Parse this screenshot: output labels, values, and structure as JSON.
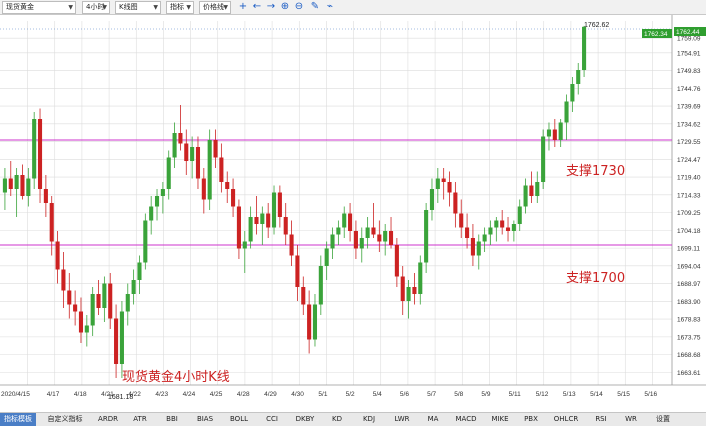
{
  "toolbar": {
    "symbol": "现货黄金",
    "period": "4小时",
    "chart_type": "K线图",
    "indicator": "指标",
    "price_type": "价格线",
    "icons": [
      "crosshair-icon",
      "arrow-left-icon",
      "arrow-right-icon",
      "zoom-in-icon",
      "zoom-out-icon",
      "draw-icon",
      "link-icon"
    ]
  },
  "annotations": {
    "title": "现货黄金4小时K线",
    "support_1730": "支撑1730",
    "support_1700": "支撑1700",
    "high_label": "1762.62",
    "low_label": "1681.18",
    "current_price": "1762.34",
    "current_price_right": "1762.44"
  },
  "colors": {
    "up": "#3aa33a",
    "down": "#cc2222",
    "support_line": "#cc33cc",
    "grid": "#dcdcdc",
    "price_tag": "#2f9e2f"
  },
  "chart_data": {
    "type": "candlestick",
    "title": "现货黄金4小时K线",
    "y_ticks": [
      "1759.09",
      "1754.91",
      "1749.83",
      "1744.76",
      "1739.69",
      "1734.62",
      "1729.55",
      "1724.47",
      "1719.40",
      "1714.33",
      "1709.25",
      "1704.18",
      "1699.11",
      "1694.04",
      "1688.97",
      "1683.90",
      "1678.83",
      "1673.75",
      "1668.68",
      "1663.61"
    ],
    "x_ticks": [
      "2020/4/15",
      "4/17",
      "4/18",
      "4/21",
      "4/22",
      "4/23",
      "4/24",
      "4/25",
      "4/28",
      "4/29",
      "4/30",
      "5/1",
      "5/2",
      "5/4",
      "5/6",
      "5/7",
      "5/8",
      "5/9",
      "5/11",
      "5/12",
      "5/13",
      "5/14",
      "5/15",
      "5/16"
    ],
    "ylim": [
      1660,
      1764
    ],
    "support_levels": [
      1730,
      1700
    ],
    "high": 1762.62,
    "low": 1681.18,
    "series": [
      {
        "o": 1715,
        "h": 1722,
        "l": 1710,
        "c": 1719
      },
      {
        "o": 1719,
        "h": 1724,
        "l": 1714,
        "c": 1716
      },
      {
        "o": 1716,
        "h": 1722,
        "l": 1708,
        "c": 1720
      },
      {
        "o": 1720,
        "h": 1723,
        "l": 1713,
        "c": 1714
      },
      {
        "o": 1714,
        "h": 1722,
        "l": 1711,
        "c": 1719
      },
      {
        "o": 1719,
        "h": 1738,
        "l": 1716,
        "c": 1736
      },
      {
        "o": 1736,
        "h": 1739,
        "l": 1712,
        "c": 1716
      },
      {
        "o": 1716,
        "h": 1720,
        "l": 1708,
        "c": 1712
      },
      {
        "o": 1712,
        "h": 1714,
        "l": 1697,
        "c": 1701
      },
      {
        "o": 1701,
        "h": 1704,
        "l": 1689,
        "c": 1693
      },
      {
        "o": 1693,
        "h": 1698,
        "l": 1682,
        "c": 1687
      },
      {
        "o": 1687,
        "h": 1692,
        "l": 1679,
        "c": 1683
      },
      {
        "o": 1683,
        "h": 1687,
        "l": 1677,
        "c": 1681
      },
      {
        "o": 1681,
        "h": 1685,
        "l": 1672,
        "c": 1675
      },
      {
        "o": 1675,
        "h": 1680,
        "l": 1671,
        "c": 1677
      },
      {
        "o": 1677,
        "h": 1688,
        "l": 1674,
        "c": 1686
      },
      {
        "o": 1686,
        "h": 1690,
        "l": 1680,
        "c": 1682
      },
      {
        "o": 1682,
        "h": 1691,
        "l": 1678,
        "c": 1689
      },
      {
        "o": 1689,
        "h": 1692,
        "l": 1676,
        "c": 1679
      },
      {
        "o": 1679,
        "h": 1683,
        "l": 1662,
        "c": 1666
      },
      {
        "o": 1666,
        "h": 1684,
        "l": 1662,
        "c": 1681
      },
      {
        "o": 1681,
        "h": 1689,
        "l": 1677,
        "c": 1686
      },
      {
        "o": 1686,
        "h": 1693,
        "l": 1683,
        "c": 1690
      },
      {
        "o": 1690,
        "h": 1697,
        "l": 1686,
        "c": 1695
      },
      {
        "o": 1695,
        "h": 1709,
        "l": 1693,
        "c": 1707
      },
      {
        "o": 1707,
        "h": 1714,
        "l": 1703,
        "c": 1711
      },
      {
        "o": 1711,
        "h": 1716,
        "l": 1707,
        "c": 1714
      },
      {
        "o": 1714,
        "h": 1718,
        "l": 1709,
        "c": 1716
      },
      {
        "o": 1716,
        "h": 1727,
        "l": 1713,
        "c": 1725
      },
      {
        "o": 1725,
        "h": 1735,
        "l": 1722,
        "c": 1732
      },
      {
        "o": 1732,
        "h": 1740,
        "l": 1727,
        "c": 1729
      },
      {
        "o": 1729,
        "h": 1733,
        "l": 1720,
        "c": 1724
      },
      {
        "o": 1724,
        "h": 1731,
        "l": 1719,
        "c": 1728
      },
      {
        "o": 1728,
        "h": 1731,
        "l": 1716,
        "c": 1719
      },
      {
        "o": 1719,
        "h": 1722,
        "l": 1709,
        "c": 1713
      },
      {
        "o": 1713,
        "h": 1733,
        "l": 1710,
        "c": 1730
      },
      {
        "o": 1730,
        "h": 1733,
        "l": 1722,
        "c": 1725
      },
      {
        "o": 1725,
        "h": 1729,
        "l": 1715,
        "c": 1718
      },
      {
        "o": 1718,
        "h": 1721,
        "l": 1712,
        "c": 1716
      },
      {
        "o": 1716,
        "h": 1719,
        "l": 1708,
        "c": 1711
      },
      {
        "o": 1711,
        "h": 1713,
        "l": 1696,
        "c": 1699
      },
      {
        "o": 1699,
        "h": 1704,
        "l": 1692,
        "c": 1701
      },
      {
        "o": 1701,
        "h": 1711,
        "l": 1699,
        "c": 1708
      },
      {
        "o": 1708,
        "h": 1714,
        "l": 1703,
        "c": 1706
      },
      {
        "o": 1706,
        "h": 1711,
        "l": 1700,
        "c": 1709
      },
      {
        "o": 1709,
        "h": 1712,
        "l": 1702,
        "c": 1705
      },
      {
        "o": 1705,
        "h": 1717,
        "l": 1703,
        "c": 1715
      },
      {
        "o": 1715,
        "h": 1717,
        "l": 1705,
        "c": 1708
      },
      {
        "o": 1708,
        "h": 1712,
        "l": 1700,
        "c": 1703
      },
      {
        "o": 1703,
        "h": 1707,
        "l": 1694,
        "c": 1697
      },
      {
        "o": 1697,
        "h": 1700,
        "l": 1684,
        "c": 1688
      },
      {
        "o": 1688,
        "h": 1691,
        "l": 1680,
        "c": 1683
      },
      {
        "o": 1683,
        "h": 1687,
        "l": 1669,
        "c": 1673
      },
      {
        "o": 1673,
        "h": 1686,
        "l": 1671,
        "c": 1683
      },
      {
        "o": 1683,
        "h": 1697,
        "l": 1680,
        "c": 1694
      },
      {
        "o": 1694,
        "h": 1701,
        "l": 1690,
        "c": 1699
      },
      {
        "o": 1699,
        "h": 1705,
        "l": 1696,
        "c": 1703
      },
      {
        "o": 1703,
        "h": 1707,
        "l": 1700,
        "c": 1705
      },
      {
        "o": 1705,
        "h": 1711,
        "l": 1702,
        "c": 1709
      },
      {
        "o": 1709,
        "h": 1712,
        "l": 1701,
        "c": 1704
      },
      {
        "o": 1704,
        "h": 1707,
        "l": 1696,
        "c": 1699
      },
      {
        "o": 1699,
        "h": 1705,
        "l": 1695,
        "c": 1702
      },
      {
        "o": 1702,
        "h": 1708,
        "l": 1699,
        "c": 1705
      },
      {
        "o": 1705,
        "h": 1712,
        "l": 1702,
        "c": 1703
      },
      {
        "o": 1703,
        "h": 1707,
        "l": 1698,
        "c": 1701
      },
      {
        "o": 1701,
        "h": 1706,
        "l": 1697,
        "c": 1704
      },
      {
        "o": 1704,
        "h": 1708,
        "l": 1699,
        "c": 1700
      },
      {
        "o": 1700,
        "h": 1702,
        "l": 1688,
        "c": 1691
      },
      {
        "o": 1691,
        "h": 1694,
        "l": 1680,
        "c": 1684
      },
      {
        "o": 1684,
        "h": 1690,
        "l": 1679,
        "c": 1688
      },
      {
        "o": 1688,
        "h": 1692,
        "l": 1683,
        "c": 1686
      },
      {
        "o": 1686,
        "h": 1697,
        "l": 1683,
        "c": 1695
      },
      {
        "o": 1695,
        "h": 1712,
        "l": 1692,
        "c": 1710
      },
      {
        "o": 1710,
        "h": 1719,
        "l": 1707,
        "c": 1716
      },
      {
        "o": 1716,
        "h": 1722,
        "l": 1712,
        "c": 1719
      },
      {
        "o": 1719,
        "h": 1722,
        "l": 1713,
        "c": 1718
      },
      {
        "o": 1718,
        "h": 1721,
        "l": 1711,
        "c": 1715
      },
      {
        "o": 1715,
        "h": 1718,
        "l": 1705,
        "c": 1709
      },
      {
        "o": 1709,
        "h": 1713,
        "l": 1702,
        "c": 1705
      },
      {
        "o": 1705,
        "h": 1709,
        "l": 1699,
        "c": 1702
      },
      {
        "o": 1702,
        "h": 1706,
        "l": 1694,
        "c": 1697
      },
      {
        "o": 1697,
        "h": 1703,
        "l": 1693,
        "c": 1701
      },
      {
        "o": 1701,
        "h": 1705,
        "l": 1698,
        "c": 1703
      },
      {
        "o": 1703,
        "h": 1707,
        "l": 1700,
        "c": 1705
      },
      {
        "o": 1705,
        "h": 1708,
        "l": 1701,
        "c": 1707
      },
      {
        "o": 1707,
        "h": 1710,
        "l": 1703,
        "c": 1705
      },
      {
        "o": 1705,
        "h": 1708,
        "l": 1701,
        "c": 1704
      },
      {
        "o": 1704,
        "h": 1707,
        "l": 1701,
        "c": 1706
      },
      {
        "o": 1706,
        "h": 1713,
        "l": 1704,
        "c": 1711
      },
      {
        "o": 1711,
        "h": 1719,
        "l": 1709,
        "c": 1717
      },
      {
        "o": 1717,
        "h": 1721,
        "l": 1712,
        "c": 1714
      },
      {
        "o": 1714,
        "h": 1721,
        "l": 1712,
        "c": 1718
      },
      {
        "o": 1718,
        "h": 1733,
        "l": 1716,
        "c": 1731
      },
      {
        "o": 1731,
        "h": 1735,
        "l": 1727,
        "c": 1733
      },
      {
        "o": 1733,
        "h": 1736,
        "l": 1728,
        "c": 1730
      },
      {
        "o": 1730,
        "h": 1736,
        "l": 1728,
        "c": 1735
      },
      {
        "o": 1735,
        "h": 1743,
        "l": 1730,
        "c": 1741
      },
      {
        "o": 1741,
        "h": 1748,
        "l": 1738,
        "c": 1746
      },
      {
        "o": 1746,
        "h": 1752,
        "l": 1743,
        "c": 1750
      },
      {
        "o": 1750,
        "h": 1762.62,
        "l": 1748,
        "c": 1762.34
      }
    ]
  },
  "tabs": [
    "指标模板",
    "自定义指标",
    "ARDR",
    "ATR",
    "BBI",
    "BIAS",
    "BOLL",
    "CCI",
    "DKBY",
    "KD",
    "KDJ",
    "LWR",
    "MA",
    "MACD",
    "MIKE",
    "PBX",
    "OHLCR",
    "RSI",
    "WR",
    "设置"
  ],
  "active_tab": 0
}
